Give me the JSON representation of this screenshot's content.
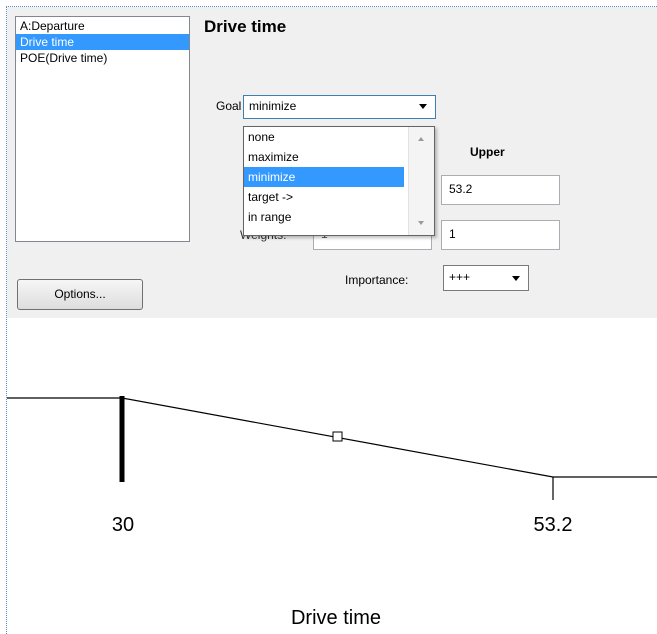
{
  "responses": {
    "items": [
      {
        "label": "A:Departure",
        "selected": false
      },
      {
        "label": "Drive time",
        "selected": true
      },
      {
        "label": "POE(Drive time)",
        "selected": false
      }
    ]
  },
  "criteria": {
    "title": "Drive time",
    "goal_label": "Goal",
    "goal_value": "minimize",
    "goal_options": [
      {
        "label": "none",
        "selected": false
      },
      {
        "label": "maximize",
        "selected": false
      },
      {
        "label": "minimize",
        "selected": true
      },
      {
        "label": "target ->",
        "selected": false
      },
      {
        "label": "in range",
        "selected": false
      }
    ],
    "upper_label": "Upper",
    "upper_limit": "53.2",
    "weights_label": "Weights:",
    "weight_lower": "1",
    "weight_upper": "1",
    "importance_label": "Importance:",
    "importance_value": "+++",
    "options_button": "Options..."
  },
  "plot": {
    "low_label": "30",
    "high_label": "53.2",
    "axis_title": "Drive time",
    "goal_shape": "minimize",
    "line_color": "#000000"
  },
  "colors": {
    "selection": "#3399ff",
    "panel_bg": "#f0f0f0",
    "frame_dotted": "#5a8fd0"
  }
}
